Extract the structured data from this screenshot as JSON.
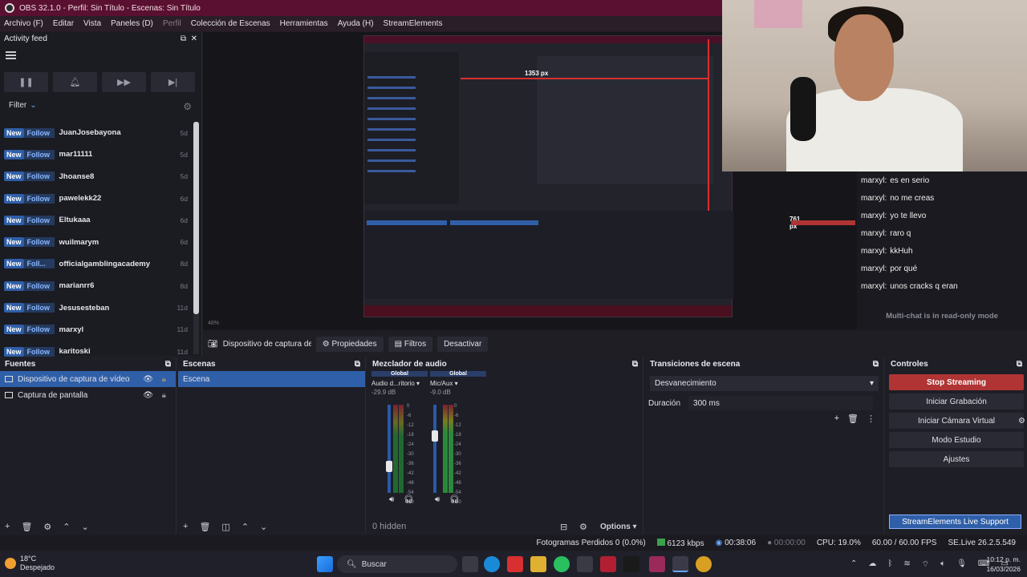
{
  "window": {
    "title": "OBS 32.1.0 - Perfil: Sin Título - Escenas: Sin Título"
  },
  "menu": [
    "Archivo (F)",
    "Editar",
    "Vista",
    "Paneles (D)",
    "Perfil",
    "Colección de Escenas",
    "Herramientas",
    "Ayuda (H)",
    "StreamElements"
  ],
  "activity": {
    "title": "Activity feed",
    "filter_label": "Filter",
    "new_label": "New",
    "items": [
      {
        "type": "Follow",
        "name": "JuanJosebayona",
        "time": "5d"
      },
      {
        "type": "Follow",
        "name": "mar11111",
        "time": "5d"
      },
      {
        "type": "Follow",
        "name": "Jhoanse8",
        "time": "5d"
      },
      {
        "type": "Follow",
        "name": "pawelekk22",
        "time": "6d"
      },
      {
        "type": "Follow",
        "name": "Eltukaaa",
        "time": "6d"
      },
      {
        "type": "Follow",
        "name": "wuilmarym",
        "time": "6d"
      },
      {
        "type": "Foll...",
        "name": "officialgamblingacademy",
        "time": "8d"
      },
      {
        "type": "Follow",
        "name": "marianrr6",
        "time": "8d"
      },
      {
        "type": "Follow",
        "name": "Jesusesteban",
        "time": "11d"
      },
      {
        "type": "Follow",
        "name": "marxyl",
        "time": "11d"
      },
      {
        "type": "Follow",
        "name": "karitoski",
        "time": "11d"
      }
    ]
  },
  "preview": {
    "px_label_1": "1353 px",
    "px_label_2": "761 px",
    "zoom": "48%"
  },
  "chat": {
    "messages": [
      {
        "user": "marxyl:",
        "text": "es en serio"
      },
      {
        "user": "marxyl:",
        "text": "no me creas"
      },
      {
        "user": "marxyl:",
        "text": "yo te llevo"
      },
      {
        "user": "marxyl:",
        "text": "raro q"
      },
      {
        "user": "marxyl:",
        "text": "kkHuh"
      },
      {
        "user": "marxyl:",
        "text": "por qué"
      },
      {
        "user": "marxyl:",
        "text": "unos cracks q eran"
      }
    ],
    "readonly": "Multi-chat is in read-only mode"
  },
  "ctxbar": {
    "source": "Dispositivo de captura de v",
    "properties": "Propiedades",
    "filters": "Filtros",
    "deactivate": "Desactivar"
  },
  "sources": {
    "title": "Fuentes",
    "items": [
      "Dispositivo de captura de vídeo",
      "Captura de pantalla"
    ]
  },
  "scenes": {
    "title": "Escenas",
    "items": [
      "Escena"
    ]
  },
  "mixer": {
    "title": "Mezclador de audio",
    "global": "Global",
    "channels": [
      {
        "name": "Audio d...ritorio",
        "db": "-29.9 dB",
        "level": 0.3
      },
      {
        "name": "Mic/Aux",
        "db": "-9.0 dB",
        "level": 0.65
      }
    ],
    "scale": [
      "0",
      "-6",
      "-12",
      "-18",
      "-24",
      "-30",
      "-36",
      "-42",
      "-48",
      "-54",
      "-60"
    ],
    "hidden": "0 hidden",
    "options": "Options"
  },
  "transitions": {
    "title": "Transiciones de escena",
    "selected": "Desvanecimiento",
    "duration_label": "Duración",
    "duration_value": "300 ms"
  },
  "controls": {
    "title": "Controles",
    "buttons": [
      "Stop Streaming",
      "Iniciar Grabación",
      "Iniciar Cámara Virtual",
      "Modo Estudio",
      "Ajustes"
    ],
    "support": "StreamElements Live Support"
  },
  "status": {
    "dropped": "Fotogramas Perdidos 0 (0.0%)",
    "kbps": "6123 kbps",
    "live_time": "00:38:06",
    "rec_time": "00:00:00",
    "cpu": "CPU: 19.0%",
    "fps": "60.00 / 60.00 FPS",
    "se_version": "SE.Live 26.2.5.549"
  },
  "taskbar": {
    "temp": "18°C",
    "weather": "Despejado",
    "search": "Buscar",
    "time": "10:12 p. m.",
    "date": "16/03/2026"
  },
  "colors": {
    "accent": "#2f5fa8",
    "stop": "#b03434",
    "title": "#5a1030"
  }
}
